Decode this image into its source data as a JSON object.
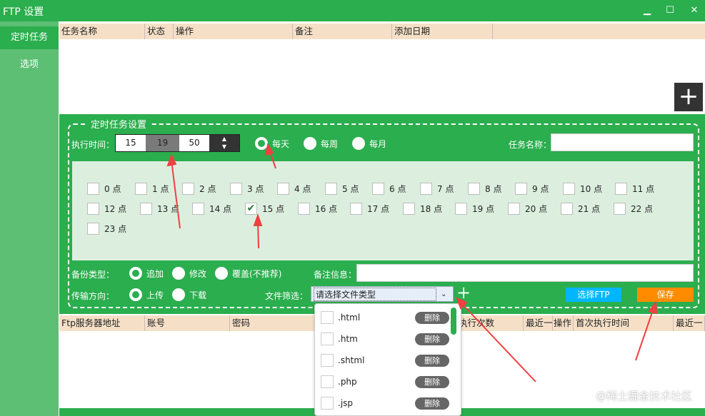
{
  "window": {
    "title": "FTP 设置",
    "minimize": "▁",
    "maximize": "☐",
    "close": "✕"
  },
  "sidebar": {
    "items": [
      {
        "label": "定时任务",
        "selected": true
      },
      {
        "label": "选项",
        "selected": false
      }
    ]
  },
  "task_table": {
    "columns": [
      "任务名称",
      "状态",
      "操作",
      "备注",
      "添加日期"
    ],
    "add_button": "+"
  },
  "settings": {
    "legend": "定时任务设置",
    "exec_time_label": "执行时间：",
    "time": {
      "hour": "15",
      "minute": "19",
      "second": "50"
    },
    "frequency": [
      {
        "label": "每天",
        "checked": true
      },
      {
        "label": "每周",
        "checked": false
      },
      {
        "label": "每月",
        "checked": false
      }
    ],
    "task_name_label": "任务名称：",
    "task_name_value": "",
    "hours": [
      {
        "label": "0 点",
        "checked": false
      },
      {
        "label": "1 点",
        "checked": false
      },
      {
        "label": "2 点",
        "checked": false
      },
      {
        "label": "3 点",
        "checked": false
      },
      {
        "label": "4 点",
        "checked": false
      },
      {
        "label": "5 点",
        "checked": false
      },
      {
        "label": "6 点",
        "checked": false
      },
      {
        "label": "7 点",
        "checked": false
      },
      {
        "label": "8 点",
        "checked": false
      },
      {
        "label": "9 点",
        "checked": false
      },
      {
        "label": "10 点",
        "checked": false
      },
      {
        "label": "11 点",
        "checked": false
      },
      {
        "label": "12 点",
        "checked": false
      },
      {
        "label": "13 点",
        "checked": false
      },
      {
        "label": "14 点",
        "checked": false
      },
      {
        "label": "15 点",
        "checked": true
      },
      {
        "label": "16 点",
        "checked": false
      },
      {
        "label": "17 点",
        "checked": false
      },
      {
        "label": "18 点",
        "checked": false
      },
      {
        "label": "19 点",
        "checked": false
      },
      {
        "label": "20 点",
        "checked": false
      },
      {
        "label": "21 点",
        "checked": false
      },
      {
        "label": "22 点",
        "checked": false
      },
      {
        "label": "23 点",
        "checked": false
      }
    ],
    "backup_type_label": "备份类型：",
    "backup_types": [
      {
        "label": "追加",
        "checked": true
      },
      {
        "label": "修改",
        "checked": false
      },
      {
        "label": "覆盖(不推荐)",
        "checked": false
      }
    ],
    "remark_label": "备注信息：",
    "remark_value": "",
    "direction_label": "传输方向：",
    "directions": [
      {
        "label": "上传",
        "checked": true
      },
      {
        "label": "下载",
        "checked": false
      }
    ],
    "file_filter_label": "文件筛选：",
    "file_filter_value": "请选择文件类型",
    "add_filter": "+",
    "select_ftp": "选择FTP",
    "save": "保存",
    "colors": {
      "select_ftp": "#00b7ff",
      "save": "#ff8c00",
      "green": "#2bae4e"
    }
  },
  "file_types": [
    {
      "label": ".html"
    },
    {
      "label": ".htm"
    },
    {
      "label": ".shtml"
    },
    {
      "label": ".php"
    },
    {
      "label": ".jsp"
    }
  ],
  "delete_label": "删除",
  "ftp_table": {
    "columns": [
      "Ftp服务器地址",
      "账号",
      "密码",
      "执行次数",
      "最近一",
      "操作",
      "首次执行时间",
      "最近一"
    ]
  },
  "watermark": "@稀土掘金技术社区"
}
